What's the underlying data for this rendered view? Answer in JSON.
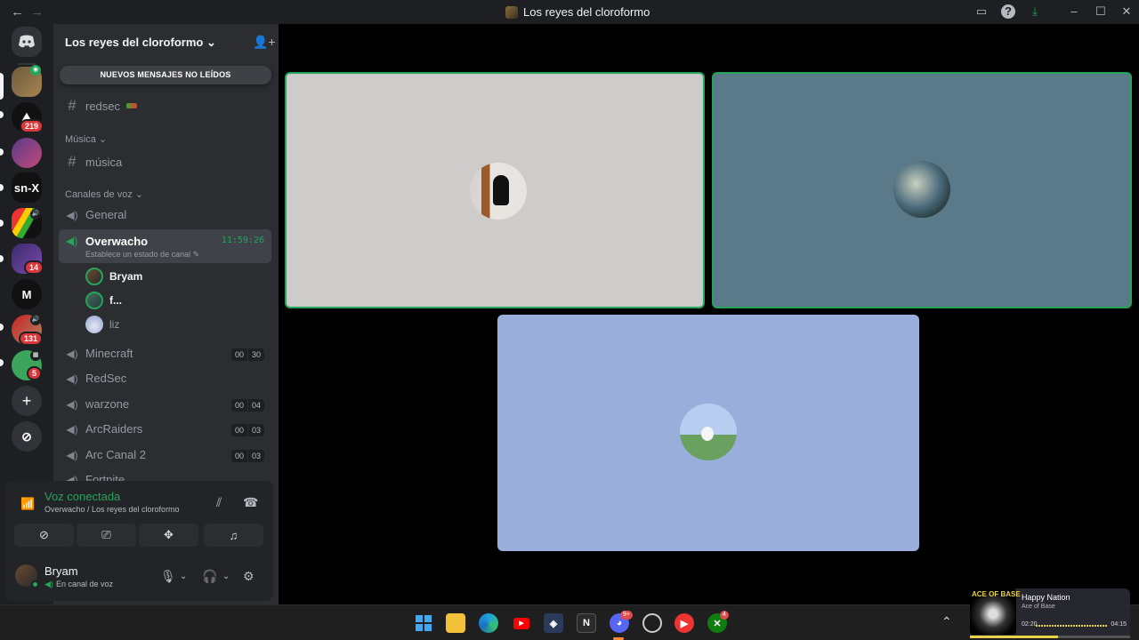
{
  "window": {
    "title": "Los reyes del cloroformo",
    "back_icon": "arrow-left-icon",
    "forward_icon": "arrow-right-icon"
  },
  "rail": {
    "servers": [
      {
        "name": "server-1",
        "badge": ""
      },
      {
        "name": "server-2",
        "badge": "219"
      },
      {
        "name": "server-3",
        "badge": ""
      },
      {
        "name": "server-4",
        "label": "sn-X",
        "badge": ""
      },
      {
        "name": "server-5",
        "badge": ""
      },
      {
        "name": "server-6",
        "badge": "14"
      },
      {
        "name": "server-7",
        "label": "M",
        "badge": ""
      },
      {
        "name": "server-8",
        "badge": "131"
      },
      {
        "name": "server-9",
        "badge": "5"
      }
    ]
  },
  "server": {
    "name": "Los reyes del cloroformo",
    "unread_banner": "NUEVOS MENSAJES NO LEÍDOS"
  },
  "channels": {
    "text_redsec": "redsec",
    "cat_musica": "Música",
    "text_musica": "música",
    "cat_voz": "Canales de voz",
    "general": "General",
    "overwacho": "Overwacho",
    "overwacho_timer": "11:59:26",
    "overwacho_status": "Establece un estado de canal",
    "members": [
      "Bryam",
      "f...",
      "liz"
    ],
    "minecraft": "Minecraft",
    "minecraft_pills": [
      "00",
      "30"
    ],
    "redsec_voice": "RedSec",
    "warzone": "warzone",
    "warzone_pills": [
      "00",
      "04"
    ],
    "arcraiders": "ArcRaiders",
    "arcraiders_pills": [
      "00",
      "03"
    ],
    "arccanal": "Arc Canal 2",
    "arccanal_pills": [
      "00",
      "03"
    ],
    "fortnite": "Fortnite"
  },
  "voice": {
    "title": "Voz conectada",
    "subtitle": "Overwacho / Los reyes del cloroformo"
  },
  "user": {
    "name": "Bryam",
    "status": "En canal de voz"
  },
  "media": {
    "art_text": "ACE OF BASE",
    "song": "Happy Nation",
    "artist": "Ace of Base",
    "elapsed": "02:20",
    "total": "04:15",
    "progress": 0.55
  },
  "taskbar": {
    "discord_badge": "9+",
    "xbox_badge": "4"
  },
  "colors": {
    "speaking": "#23a55a",
    "tile_1": "#cecbcb",
    "tile_2": "#5a7a8a",
    "tile_3": "#9aaedb"
  }
}
